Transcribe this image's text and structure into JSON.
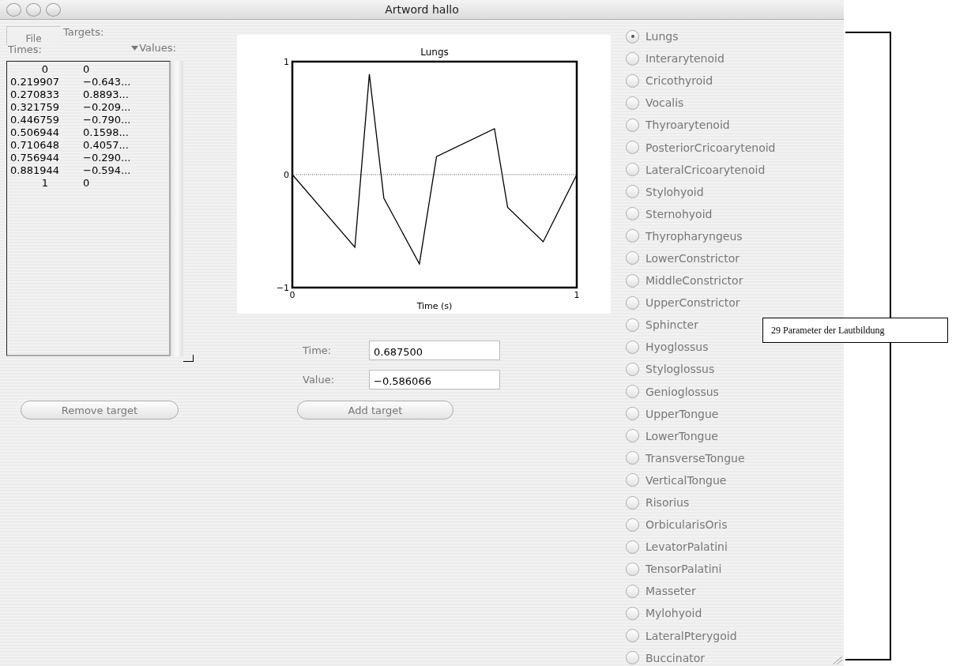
{
  "window": {
    "title": "Artword hallo"
  },
  "file_menu": "File",
  "targets_label": "Targets:",
  "columns": [
    "Times:",
    "Values:"
  ],
  "targets": [
    {
      "time": "0",
      "value": "0"
    },
    {
      "time": "0.219907",
      "value": "−0.643..."
    },
    {
      "time": "0.270833",
      "value": "0.8893..."
    },
    {
      "time": "0.321759",
      "value": "−0.209..."
    },
    {
      "time": "0.446759",
      "value": "−0.790..."
    },
    {
      "time": "0.506944",
      "value": "0.1598..."
    },
    {
      "time": "0.710648",
      "value": "0.4057..."
    },
    {
      "time": "0.756944",
      "value": "−0.290..."
    },
    {
      "time": "0.881944",
      "value": "−0.594..."
    },
    {
      "time": "1",
      "value": "0"
    }
  ],
  "chart": {
    "chart_data": {
      "type": "line",
      "title": "Lungs",
      "xlabel": "Time (s)",
      "x": [
        0,
        0.219907,
        0.270833,
        0.321759,
        0.446759,
        0.506944,
        0.710648,
        0.756944,
        0.881944,
        1
      ],
      "series": [
        {
          "color": "#000000",
          "values": [
            0,
            -0.643,
            0.889,
            -0.209,
            -0.79,
            0.16,
            0.406,
            -0.29,
            -0.594,
            0
          ]
        }
      ],
      "xlim": [
        0,
        1
      ],
      "ylim": [
        -1,
        1
      ],
      "xticks": [
        0,
        1
      ],
      "yticks": [
        {
          "value": -1,
          "label": "−1"
        },
        0,
        1
      ]
    }
  },
  "time_field": {
    "label": "Time:",
    "value": "0.687500"
  },
  "value_field": {
    "label": "Value:",
    "value": "−0.586066"
  },
  "remove_button": "Remove target",
  "add_button": "Add target",
  "muscles": [
    {
      "label": "Lungs",
      "selected": true
    },
    {
      "label": "Interarytenoid",
      "selected": false
    },
    {
      "label": "Cricothyroid",
      "selected": false
    },
    {
      "label": "Vocalis",
      "selected": false
    },
    {
      "label": "Thyroarytenoid",
      "selected": false
    },
    {
      "label": "PosteriorCricoarytenoid",
      "selected": false
    },
    {
      "label": "LateralCricoarytenoid",
      "selected": false
    },
    {
      "label": "Stylohyoid",
      "selected": false
    },
    {
      "label": "Sternohyoid",
      "selected": false
    },
    {
      "label": "Thyropharyngeus",
      "selected": false
    },
    {
      "label": "LowerConstrictor",
      "selected": false
    },
    {
      "label": "MiddleConstrictor",
      "selected": false
    },
    {
      "label": "UpperConstrictor",
      "selected": false
    },
    {
      "label": "Sphincter",
      "selected": false
    },
    {
      "label": "Hyoglossus",
      "selected": false
    },
    {
      "label": "Styloglossus",
      "selected": false
    },
    {
      "label": "Genioglossus",
      "selected": false
    },
    {
      "label": "UpperTongue",
      "selected": false
    },
    {
      "label": "LowerTongue",
      "selected": false
    },
    {
      "label": "TransverseTongue",
      "selected": false
    },
    {
      "label": "VerticalTongue",
      "selected": false
    },
    {
      "label": "Risorius",
      "selected": false
    },
    {
      "label": "OrbicularisOris",
      "selected": false
    },
    {
      "label": "LevatorPalatini",
      "selected": false
    },
    {
      "label": "TensorPalatini",
      "selected": false
    },
    {
      "label": "Masseter",
      "selected": false
    },
    {
      "label": "Mylohyoid",
      "selected": false
    },
    {
      "label": "LateralPterygoid",
      "selected": false
    },
    {
      "label": "Buccinator",
      "selected": false
    }
  ],
  "annotation": {
    "label": "29 Parameter der Lautbildung"
  }
}
